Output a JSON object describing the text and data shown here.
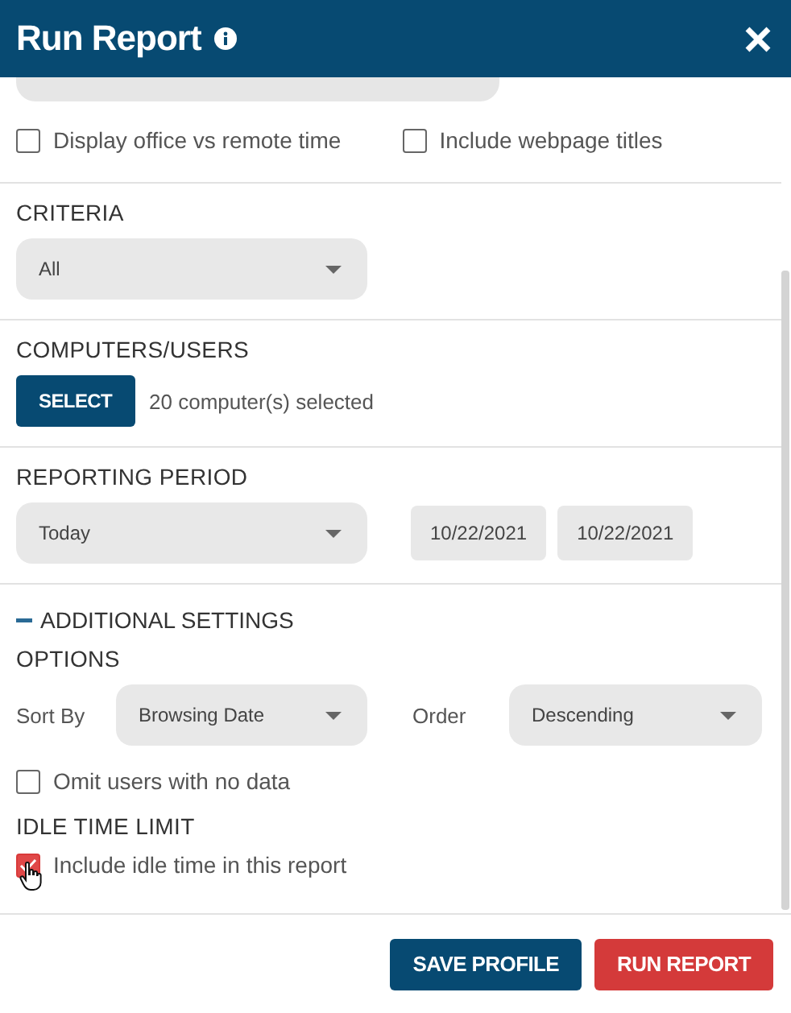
{
  "header": {
    "title": "Run Report"
  },
  "display_options": [
    {
      "label": "Display office vs remote time",
      "checked": false
    },
    {
      "label": "Include webpage titles",
      "checked": false
    }
  ],
  "criteria": {
    "heading": "CRITERIA",
    "value": "All"
  },
  "computers": {
    "heading": "COMPUTERS/USERS",
    "button": "SELECT",
    "status": "20 computer(s) selected"
  },
  "period": {
    "heading": "REPORTING PERIOD",
    "value": "Today",
    "start": "10/22/2021",
    "end": "10/22/2021"
  },
  "additional": {
    "label": "ADDITIONAL SETTINGS",
    "expanded": true
  },
  "options": {
    "heading": "OPTIONS",
    "sort_label": "Sort By",
    "sort_value": "Browsing Date",
    "order_label": "Order",
    "order_value": "Descending"
  },
  "omit": {
    "label": "Omit users with no data",
    "checked": false
  },
  "idle": {
    "heading": "IDLE TIME LIMIT",
    "label": "Include idle time in this report",
    "checked": true
  },
  "buttons": [
    {
      "label": "SAVE PROFILE",
      "kind": "secondary"
    },
    {
      "label": "RUN REPORT",
      "kind": "primary"
    }
  ]
}
